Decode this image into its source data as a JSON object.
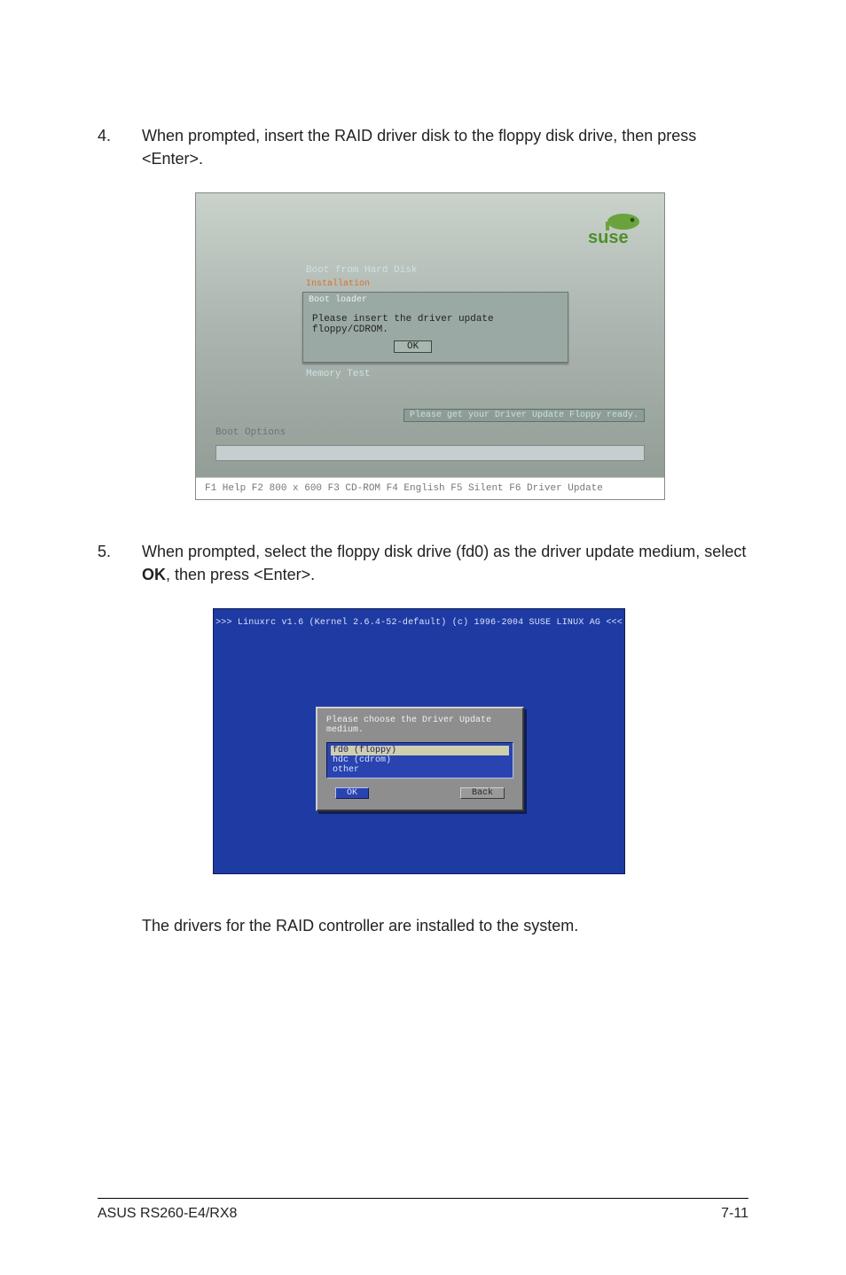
{
  "step4": {
    "num": "4.",
    "text_a": "When prompted, insert the RAID driver disk to the floppy disk drive, then press <Enter>."
  },
  "suse": {
    "logo_text": "suse",
    "menu": {
      "boot_from_hd": "Boot from Hard Disk",
      "installation": "Installation"
    },
    "modal_title": "Boot loader",
    "modal_msg": "Please insert the driver update floppy/CDROM.",
    "ok": "OK",
    "memory_test": "Memory Test",
    "ready_msg": "Please get your Driver Update Floppy ready.",
    "boot_options": "Boot Options",
    "fnkeys": "F1 Help  F2 800 x 600  F3 CD-ROM  F4 English  F5 Silent  F6 Driver Update"
  },
  "step5": {
    "num": "5.",
    "text_a": "When prompted, select the floppy disk drive (fd0) as the driver update medium, select ",
    "bold": "OK",
    "text_b": ", then press <Enter>."
  },
  "lrc": {
    "header": ">>> Linuxrc v1.6 (Kernel 2.6.4-52-default) (c) 1996-2004 SUSE LINUX AG <<<",
    "prompt": "Please choose the Driver Update medium.",
    "opt_sel": "fd0 (floppy)",
    "opt1": "hdc (cdrom)",
    "opt2": "other",
    "ok": "OK",
    "back": "Back"
  },
  "post_note": "The drivers for the RAID controller are installed to the system.",
  "footer": {
    "left": "ASUS RS260-E4/RX8",
    "right": "7-11"
  }
}
